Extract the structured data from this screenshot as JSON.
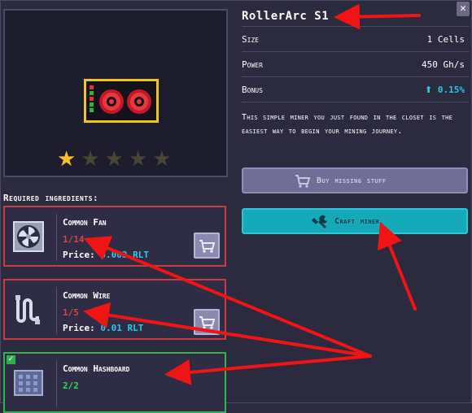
{
  "miner": {
    "name": "RollerArc S1",
    "stars_filled": 1,
    "stars_total": 5
  },
  "stats": [
    {
      "label": "Size",
      "value": "1 Cells"
    },
    {
      "label": "Power",
      "value": "450 Gh/s"
    },
    {
      "label": "Bonus",
      "value": "0.15%"
    }
  ],
  "description": "This simple miner you just found in the closet is the easiest way to begin your mining journey.",
  "buttons": {
    "buy": "Buy missing stuff",
    "craft": "Craft miner"
  },
  "ingredients_title": "Required ingredients:",
  "ingredients": [
    {
      "name": "Common Fan",
      "count": "1/14",
      "price_label": "Price:",
      "price_value": "0.003 RLT",
      "icon": "fan-icon"
    },
    {
      "name": "Common Wire",
      "count": "1/5",
      "price_label": "Price:",
      "price_value": "0.01 RLT",
      "icon": "wire-icon"
    },
    {
      "name": "Common Hashboard",
      "count": "2/2",
      "icon": "hashboard-icon"
    }
  ],
  "colors": {
    "accent": "#15aab9",
    "bonus": "#29c9e6",
    "missing": "#e04141",
    "complete": "#2fdc47",
    "arrow": "#f01414"
  }
}
